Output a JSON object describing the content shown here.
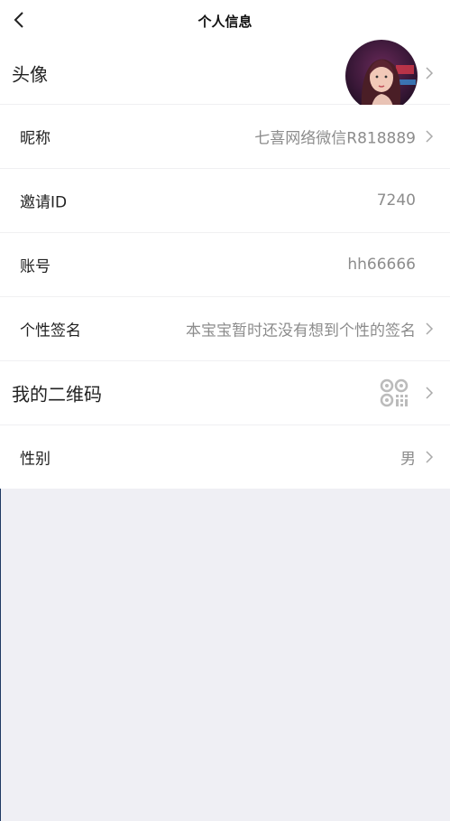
{
  "header": {
    "title": "个人信息"
  },
  "rows": {
    "avatar": {
      "label": "头像"
    },
    "nickname": {
      "label": "昵称",
      "value": "七喜网络微信R818889"
    },
    "invite_id": {
      "label": "邀请ID",
      "value": "7240"
    },
    "account": {
      "label": "账号",
      "value": "hh66666"
    },
    "signature": {
      "label": "个性签名",
      "value": "本宝宝暂时还没有想到个性的签名"
    },
    "qrcode": {
      "label": "我的二维码"
    },
    "gender": {
      "label": "性别",
      "value": "男"
    }
  },
  "icons": {
    "back": "chevron-left-icon",
    "arrow": "chevron-right-icon",
    "qrcode": "qrcode-icon"
  },
  "colors": {
    "background": "#efeff4",
    "value_text": "#8c8c8c"
  }
}
